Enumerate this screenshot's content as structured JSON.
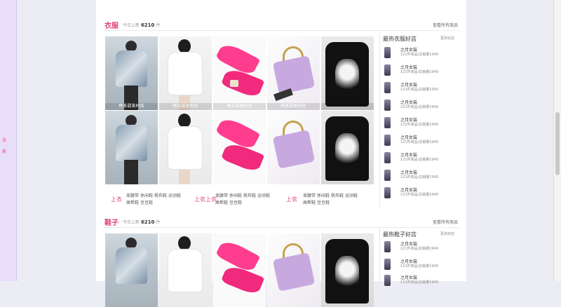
{
  "left_sidebar": {
    "label": "海   报"
  },
  "sections": [
    {
      "title": "衣服",
      "today_prefix": "今日上新",
      "today_count": "6210",
      "today_suffix": "件",
      "more_link": "查看所有商品",
      "products": [
        {
          "caption": "韩系甜美时尚"
        },
        {
          "caption": "韩系甜美时尚"
        },
        {
          "caption": "韩系甜美时尚"
        },
        {
          "caption": "韩系甜美时尚"
        },
        {
          "caption": ""
        },
        {
          "caption": ""
        },
        {
          "caption": ""
        },
        {
          "caption": ""
        },
        {
          "caption": ""
        },
        {
          "caption": ""
        }
      ],
      "tag_groups": [
        {
          "main": "上衣",
          "tags": [
            "束腰带",
            "休闲鞋",
            "帆布鞋",
            "运动鞋",
            "高帮鞋",
            "豆豆鞋"
          ]
        },
        {
          "main": "上衣上衣",
          "tags": [
            "束腰带",
            "休闲鞋",
            "帆布鞋",
            "运动鞋",
            "高帮鞋",
            "豆豆鞋"
          ]
        },
        {
          "main": "上衣",
          "tags": [
            "束腰带",
            "休闲鞋",
            "帆布鞋",
            "运动鞋",
            "高帮鞋",
            "豆豆鞋"
          ]
        }
      ],
      "shop_panel": {
        "title": "最热衣服好店",
        "more": "更多好店",
        "shops": [
          {
            "name": "之月女装",
            "stats": "121件商品/总销量1949"
          },
          {
            "name": "之月女装",
            "stats": "121件商品/总销量1949"
          },
          {
            "name": "之月女装",
            "stats": "121件商品/总销量1949"
          },
          {
            "name": "之月女装",
            "stats": "121件商品/总销量1949"
          },
          {
            "name": "之月女装",
            "stats": "121件商品/总销量1949"
          },
          {
            "name": "之月女装",
            "stats": "121件商品/总销量1949"
          },
          {
            "name": "之月女装",
            "stats": "121件商品/总销量1949"
          },
          {
            "name": "之月女装",
            "stats": "121件商品/总销量1949"
          },
          {
            "name": "之月女装",
            "stats": "121件商品/总销量1949"
          }
        ]
      }
    },
    {
      "title": "鞋子",
      "today_prefix": "今日上新",
      "today_count": "6210",
      "today_suffix": "件",
      "more_link": "查看所有商品",
      "shop_panel": {
        "title": "最热鞋子好店",
        "more": "更多好店",
        "shops": [
          {
            "name": "之月女装",
            "stats": "121件商品/总销量1949"
          },
          {
            "name": "之月女装",
            "stats": "121件商品/总销量1949"
          },
          {
            "name": "之月女装",
            "stats": "121件商品/总销量1949"
          }
        ]
      }
    }
  ],
  "colors": {
    "accent": "#e33d75",
    "sidebar": "#e9defa"
  }
}
